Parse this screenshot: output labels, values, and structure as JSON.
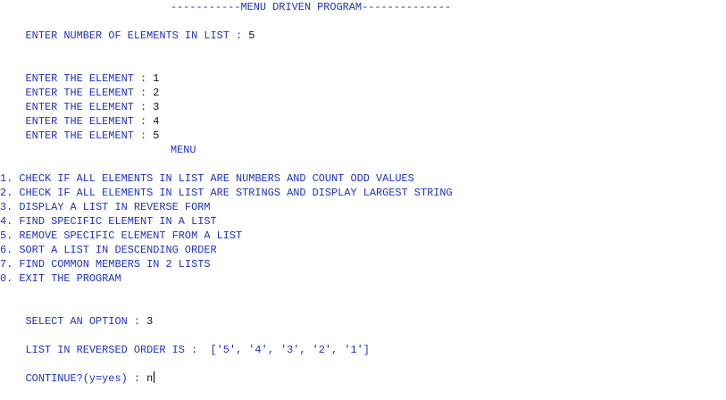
{
  "console": {
    "header": "-----------MENU DRIVEN PROGRAM--------------",
    "count_prompt": "ENTER NUMBER OF ELEMENTS IN LIST : ",
    "count_value": "5",
    "element_prompt": "ENTER THE ELEMENT : ",
    "elements": [
      "1",
      "2",
      "3",
      "4",
      "5"
    ],
    "menu_title": "MENU",
    "menu_items": [
      "1. CHECK IF ALL ELEMENTS IN LIST ARE NUMBERS AND COUNT ODD VALUES",
      "2. CHECK IF ALL ELEMENTS IN LIST ARE STRINGS AND DISPLAY LARGEST STRING",
      "3. DISPLAY A LIST IN REVERSE FORM",
      "4. FIND SPECIFIC ELEMENT IN A LIST",
      "5. REMOVE SPECIFIC ELEMENT FROM A LIST",
      "6. SORT A LIST IN DESCENDING ORDER",
      "7. FIND COMMON MEMBERS IN 2 LISTS",
      "0. EXIT THE PROGRAM"
    ],
    "option_prompt": "SELECT AN OPTION : ",
    "option_value": "3",
    "result_label": "LIST IN REVERSED ORDER IS :  ",
    "result_value": "['5', '4', '3', '2', '1']",
    "continue_prompt": "CONTINUE?(y=yes) : ",
    "continue_value": "n"
  },
  "colors": {
    "prompt_text": "#1e33c4",
    "input_text": "#111111",
    "background": "#ffffff"
  }
}
